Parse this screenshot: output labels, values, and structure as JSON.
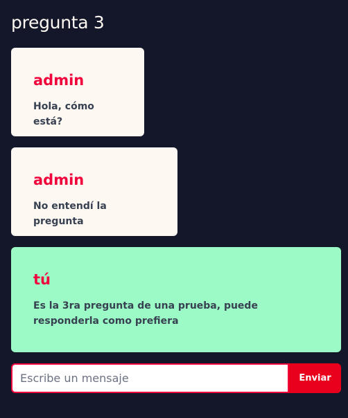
{
  "title": "pregunta 3",
  "messages": [
    {
      "author": "admin",
      "text": "Hola, cómo está?"
    },
    {
      "author": "admin",
      "text": "No entendí la pregunta"
    },
    {
      "author": "tú",
      "text": "Es la 3ra pregunta de una prueba, puede responderla como prefiera"
    }
  ],
  "composer": {
    "placeholder": "Escribe un mensaje",
    "value": "",
    "send_label": "Enviar"
  },
  "colors": {
    "background": "#14172a",
    "card": "#fdf8f1",
    "own_card": "#9cfac6",
    "accent": "#f0053c"
  }
}
